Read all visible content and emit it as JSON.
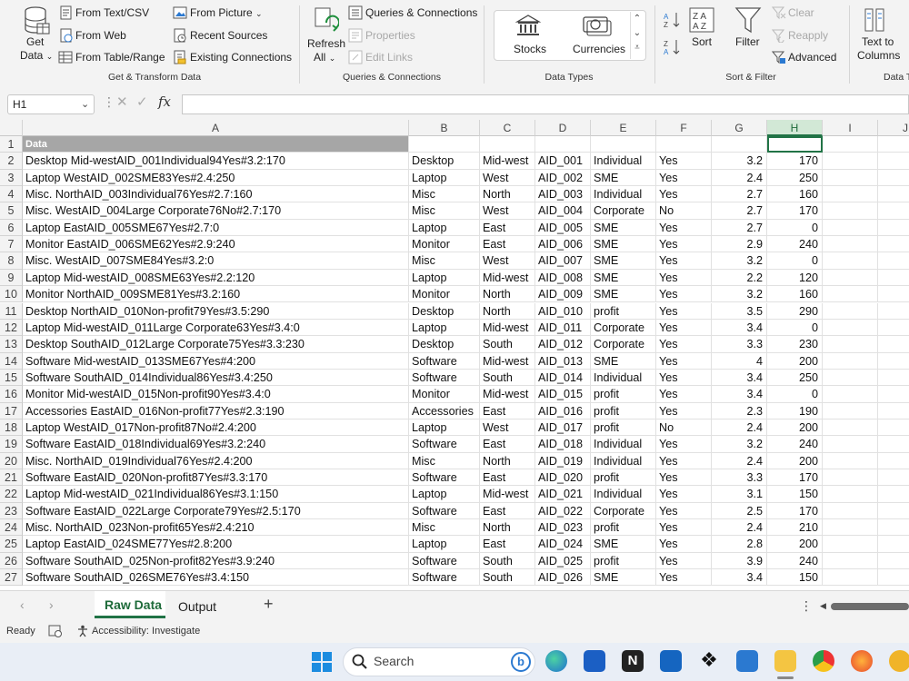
{
  "ribbon": {
    "get_data_1": "Get",
    "get_data_2": "Data",
    "from_text_csv": "From Text/CSV",
    "from_web": "From Web",
    "from_table_range": "From Table/Range",
    "from_picture": "From Picture",
    "recent_sources": "Recent Sources",
    "existing_connections": "Existing Connections",
    "group_get_transform": "Get & Transform Data",
    "refresh_all_1": "Refresh",
    "refresh_all_2": "All",
    "queries_connections": "Queries & Connections",
    "properties": "Properties",
    "edit_links": "Edit Links",
    "group_queries": "Queries & Connections",
    "stocks": "Stocks",
    "currencies": "Currencies",
    "group_data_types": "Data Types",
    "sort": "Sort",
    "filter": "Filter",
    "clear": "Clear",
    "reapply": "Reapply",
    "advanced": "Advanced",
    "group_sort_filter": "Sort & Filter",
    "text_to_columns_1": "Text to",
    "text_to_columns_2": "Columns",
    "group_data_tools": "Data T"
  },
  "formula_bar": {
    "name_box": "H1",
    "formula": ""
  },
  "grid": {
    "columns": [
      "A",
      "B",
      "C",
      "D",
      "E",
      "F",
      "G",
      "H",
      "I",
      "J"
    ],
    "selected_column": "H",
    "header_cell": "Data",
    "rows": [
      {
        "n": "1",
        "a": "Data",
        "b": "",
        "c": "",
        "d": "",
        "e": "",
        "f": "",
        "g": "",
        "h": ""
      },
      {
        "n": "2",
        "a": "Desktop    Mid-westAID_001Individual94Yes#3.2:170",
        "b": "Desktop",
        "c": "Mid-west",
        "d": "AID_001",
        "e": "Individual",
        "f": "Yes",
        "g": "3.2",
        "h": "170"
      },
      {
        "n": "3",
        "a": "Laptop        WestAID_002SME83Yes#2.4:250",
        "b": "Laptop",
        "c": "West",
        "d": "AID_002",
        "e": "SME",
        "f": "Yes",
        "g": "2.4",
        "h": "250"
      },
      {
        "n": "4",
        "a": "Misc.         NorthAID_003Individual76Yes#2.7:160",
        "b": "Misc",
        "c": "North",
        "d": "AID_003",
        "e": "Individual",
        "f": "Yes",
        "g": "2.7",
        "h": "160"
      },
      {
        "n": "5",
        "a": "Misc. WestAID_004Large Corporate76No#2.7:170",
        "b": "Misc",
        "c": "West",
        "d": "AID_004",
        "e": "Corporate",
        "f": "No",
        "g": "2.7",
        "h": "170"
      },
      {
        "n": "6",
        "a": "Laptop  EastAID_005SME67Yes#2.7:0",
        "b": "Laptop",
        "c": "East",
        "d": "AID_005",
        "e": "SME",
        "f": "Yes",
        "g": "2.7",
        "h": "0"
      },
      {
        "n": "7",
        "a": "Monitor              EastAID_006SME62Yes#2.9:240",
        "b": "Monitor",
        "c": "East",
        "d": "AID_006",
        "e": "SME",
        "f": "Yes",
        "g": "2.9",
        "h": "240"
      },
      {
        "n": "8",
        "a": "Misc.                    WestAID_007SME84Yes#3.2:0",
        "b": "Misc",
        "c": "West",
        "d": "AID_007",
        "e": "SME",
        "f": "Yes",
        "g": "3.2",
        "h": "0"
      },
      {
        "n": "9",
        "a": "Laptop   Mid-westAID_008SME63Yes#2.2:120",
        "b": "Laptop",
        "c": "Mid-west",
        "d": "AID_008",
        "e": "SME",
        "f": "Yes",
        "g": "2.2",
        "h": "120"
      },
      {
        "n": "10",
        "a": "Monitor              NorthAID_009SME81Yes#3.2:160",
        "b": "Monitor",
        "c": "North",
        "d": "AID_009",
        "e": "SME",
        "f": "Yes",
        "g": "3.2",
        "h": "160"
      },
      {
        "n": "11",
        "a": "Desktop   NorthAID_010Non-profit79Yes#3.5:290",
        "b": "Desktop",
        "c": "North",
        "d": "AID_010",
        "e": "profit",
        "f": "Yes",
        "g": "3.5",
        "h": "290"
      },
      {
        "n": "12",
        "a": "Laptop       Mid-westAID_011Large Corporate63Yes#3.4:0",
        "b": "Laptop",
        "c": "Mid-west",
        "d": "AID_011",
        "e": "Corporate",
        "f": "Yes",
        "g": "3.4",
        "h": "0"
      },
      {
        "n": "13",
        "a": "Desktop   SouthAID_012Large Corporate75Yes#3.3:230",
        "b": "Desktop",
        "c": "South",
        "d": "AID_012",
        "e": "Corporate",
        "f": "Yes",
        "g": "3.3",
        "h": "230"
      },
      {
        "n": "14",
        "a": "Software          Mid-westAID_013SME67Yes#4:200",
        "b": "Software",
        "c": "Mid-west",
        "d": "AID_013",
        "e": "SME",
        "f": "Yes",
        "g": "4",
        "h": "200"
      },
      {
        "n": "15",
        "a": "Software    SouthAID_014Individual86Yes#3.4:250",
        "b": "Software",
        "c": "South",
        "d": "AID_014",
        "e": "Individual",
        "f": "Yes",
        "g": "3.4",
        "h": "250"
      },
      {
        "n": "16",
        "a": "Monitor   Mid-westAID_015Non-profit90Yes#3.4:0",
        "b": "Monitor",
        "c": "Mid-west",
        "d": "AID_015",
        "e": "profit",
        "f": "Yes",
        "g": "3.4",
        "h": "0"
      },
      {
        "n": "17",
        "a": "Accessories        EastAID_016Non-profit77Yes#2.3:190",
        "b": "Accessories",
        "c": "East",
        "d": "AID_016",
        "e": "profit",
        "f": "Yes",
        "g": "2.3",
        "h": "190"
      },
      {
        "n": "18",
        "a": "Laptop        WestAID_017Non-profit87No#2.4:200",
        "b": "Laptop",
        "c": "West",
        "d": "AID_017",
        "e": "profit",
        "f": "No",
        "g": "2.4",
        "h": "200"
      },
      {
        "n": "19",
        "a": "Software EastAID_018Individual69Yes#3.2:240",
        "b": "Software",
        "c": "East",
        "d": "AID_018",
        "e": "Individual",
        "f": "Yes",
        "g": "3.2",
        "h": "240"
      },
      {
        "n": "20",
        "a": "Misc.   NorthAID_019Individual76Yes#2.4:200",
        "b": "Misc",
        "c": "North",
        "d": "AID_019",
        "e": "Individual",
        "f": "Yes",
        "g": "2.4",
        "h": "200"
      },
      {
        "n": "21",
        "a": "Software            EastAID_020Non-profit87Yes#3.3:170",
        "b": "Software",
        "c": "East",
        "d": "AID_020",
        "e": "profit",
        "f": "Yes",
        "g": "3.3",
        "h": "170"
      },
      {
        "n": "22",
        "a": "Laptop                   Mid-westAID_021Individual86Yes#3.1:150",
        "b": "Laptop",
        "c": "Mid-west",
        "d": "AID_021",
        "e": "Individual",
        "f": "Yes",
        "g": "3.1",
        "h": "150"
      },
      {
        "n": "23",
        "a": "Software     EastAID_022Large Corporate79Yes#2.5:170",
        "b": "Software",
        "c": "East",
        "d": "AID_022",
        "e": "Corporate",
        "f": "Yes",
        "g": "2.5",
        "h": "170"
      },
      {
        "n": "24",
        "a": "Misc.            NorthAID_023Non-profit65Yes#2.4:210",
        "b": "Misc",
        "c": "North",
        "d": "AID_023",
        "e": "profit",
        "f": "Yes",
        "g": "2.4",
        "h": "210"
      },
      {
        "n": "25",
        "a": "Laptop   EastAID_024SME77Yes#2.8:200",
        "b": "Laptop",
        "c": "East",
        "d": "AID_024",
        "e": "SME",
        "f": "Yes",
        "g": "2.8",
        "h": "200"
      },
      {
        "n": "26",
        "a": "Software      SouthAID_025Non-profit82Yes#3.9:240",
        "b": "Software",
        "c": "South",
        "d": "AID_025",
        "e": "profit",
        "f": "Yes",
        "g": "3.9",
        "h": "240"
      },
      {
        "n": "27",
        "a": "Software    SouthAID_026SME76Yes#3.4:150",
        "b": "Software",
        "c": "South",
        "d": "AID_026",
        "e": "SME",
        "f": "Yes",
        "g": "3.4",
        "h": "150"
      }
    ]
  },
  "sheets": {
    "tab1": "Raw Data",
    "tab2": "Output",
    "add": "+"
  },
  "status": {
    "ready": "Ready",
    "accessibility": "Accessibility: Investigate"
  },
  "taskbar": {
    "search_placeholder": "Search"
  },
  "colors": {
    "accent_green": "#217346",
    "selected_col_bg": "#d2e8d6",
    "header_cell_bg": "#a6a6a6"
  }
}
